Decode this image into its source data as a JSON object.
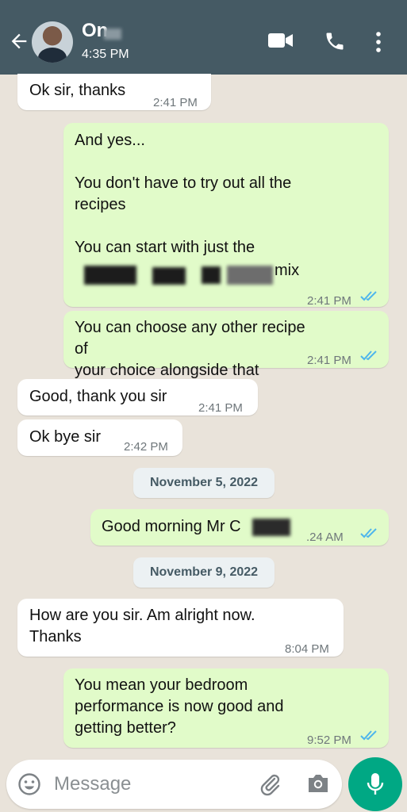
{
  "header": {
    "contact_name": "On",
    "last_seen": "4:35 PM",
    "icons": [
      "back-arrow-icon",
      "video-call-icon",
      "voice-call-icon",
      "more-options-icon"
    ],
    "color": "#455a64"
  },
  "messages": [
    {
      "dir": "in",
      "text": "Ok sir, thanks",
      "time": "2:41 PM"
    },
    {
      "dir": "out",
      "text": "And yes...\n\nYou don't have to try out all the\nrecipes\n\nYou can start with just the",
      "text_tail": "mix",
      "time": "2:41 PM",
      "read": true
    },
    {
      "dir": "out",
      "text": "You can choose any other recipe of\nyour choice alongside that",
      "time": "2:41 PM",
      "read": true
    },
    {
      "dir": "in",
      "text": "Good, thank you sir",
      "time": "2:41 PM"
    },
    {
      "dir": "in",
      "text": "Ok bye sir",
      "time": "2:42 PM"
    },
    {
      "dir": "out",
      "text": "Good morning Mr C",
      "time": ".24 AM",
      "read": true
    },
    {
      "dir": "in",
      "text": "How are you sir. Am alright now.\nThanks",
      "time": "8:04 PM"
    },
    {
      "dir": "out",
      "text": "You mean your bedroom\nperformance is now good and\ngetting better?",
      "time": "9:52 PM",
      "read": true
    }
  ],
  "date_separators": [
    "November 5, 2022",
    "November 9, 2022"
  ],
  "composer": {
    "placeholder": "Message",
    "icons": [
      "emoji-icon",
      "attach-icon",
      "camera-icon",
      "mic-icon"
    ]
  },
  "colors": {
    "outgoing_bubble": "#e1fbc9",
    "incoming_bubble": "#ffffff",
    "read_ticks": "#4fb6ec",
    "send_button": "#00a884"
  }
}
